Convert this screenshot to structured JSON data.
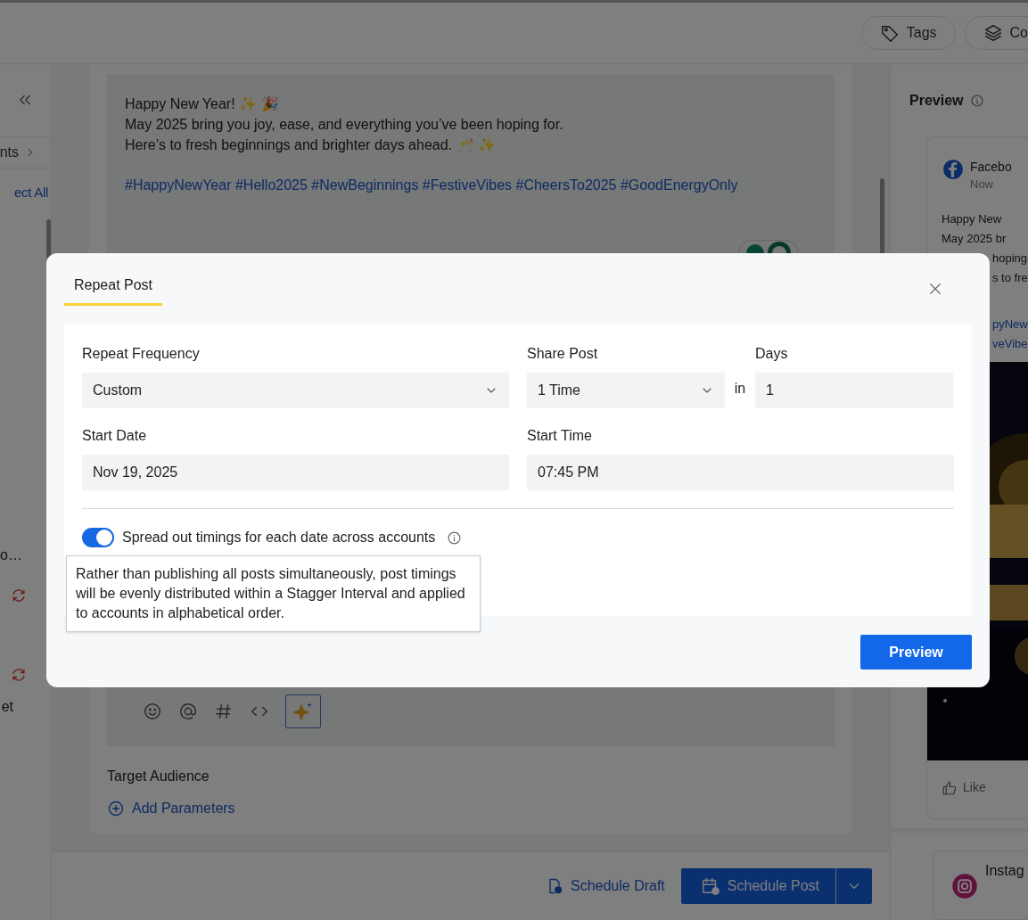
{
  "header": {
    "buttons": [
      {
        "label": "Tags"
      },
      {
        "label": "Co"
      }
    ]
  },
  "sidebar": {
    "section_label": "nts",
    "select_all": "ect All",
    "truncated_label": "o…",
    "footer_text": "et"
  },
  "editor": {
    "lines": [
      "Happy New Year! ✨ 🎉",
      "May 2025 bring you joy, ease, and everything you’ve been hoping for.",
      "Here’s to fresh beginnings and brighter days ahead.  🥂 ✨"
    ],
    "hashtags": "#HappyNewYear #Hello2025 #NewBeginnings #FestiveVibes #CheersTo2025 #GoodEnergyOnly",
    "target_audience": "Target Audience",
    "add_parameters": "Add Parameters"
  },
  "footer": {
    "schedule_draft": "Schedule Draft",
    "schedule_post": "Schedule Post"
  },
  "preview": {
    "title": "Preview",
    "post": {
      "network": "Facebo",
      "time": "Now",
      "lines": [
        "Happy New",
        "May 2025 br",
        "hoping",
        "s to fre"
      ],
      "hashtags": [
        "pyNew",
        "veVibe"
      ],
      "like": "Like"
    },
    "next_network": "Instag"
  },
  "modal": {
    "tabs": [
      {
        "label": "Repeat Post",
        "selected": true
      }
    ],
    "fields": [
      {
        "label": "Repeat Frequency",
        "value": "Custom",
        "kind": "select"
      },
      {
        "label": "Share Post",
        "value": "1 Time",
        "kind": "select"
      },
      {
        "label": "Days",
        "value": "1",
        "kind": "input"
      },
      {
        "label": "Start Date",
        "value": "Nov 19, 2025",
        "kind": "input"
      },
      {
        "label": "Start Time",
        "value": "07:45 PM",
        "kind": "input"
      }
    ],
    "share_connector": "in",
    "toggle": {
      "label": "Spread out timings for each date across accounts",
      "on": true
    },
    "tooltip": "Rather than publishing all posts simultaneously, post timings will be evenly distributed within a Stagger Interval and applied to accounts in alphabetical order.",
    "primary_button": "Preview"
  }
}
